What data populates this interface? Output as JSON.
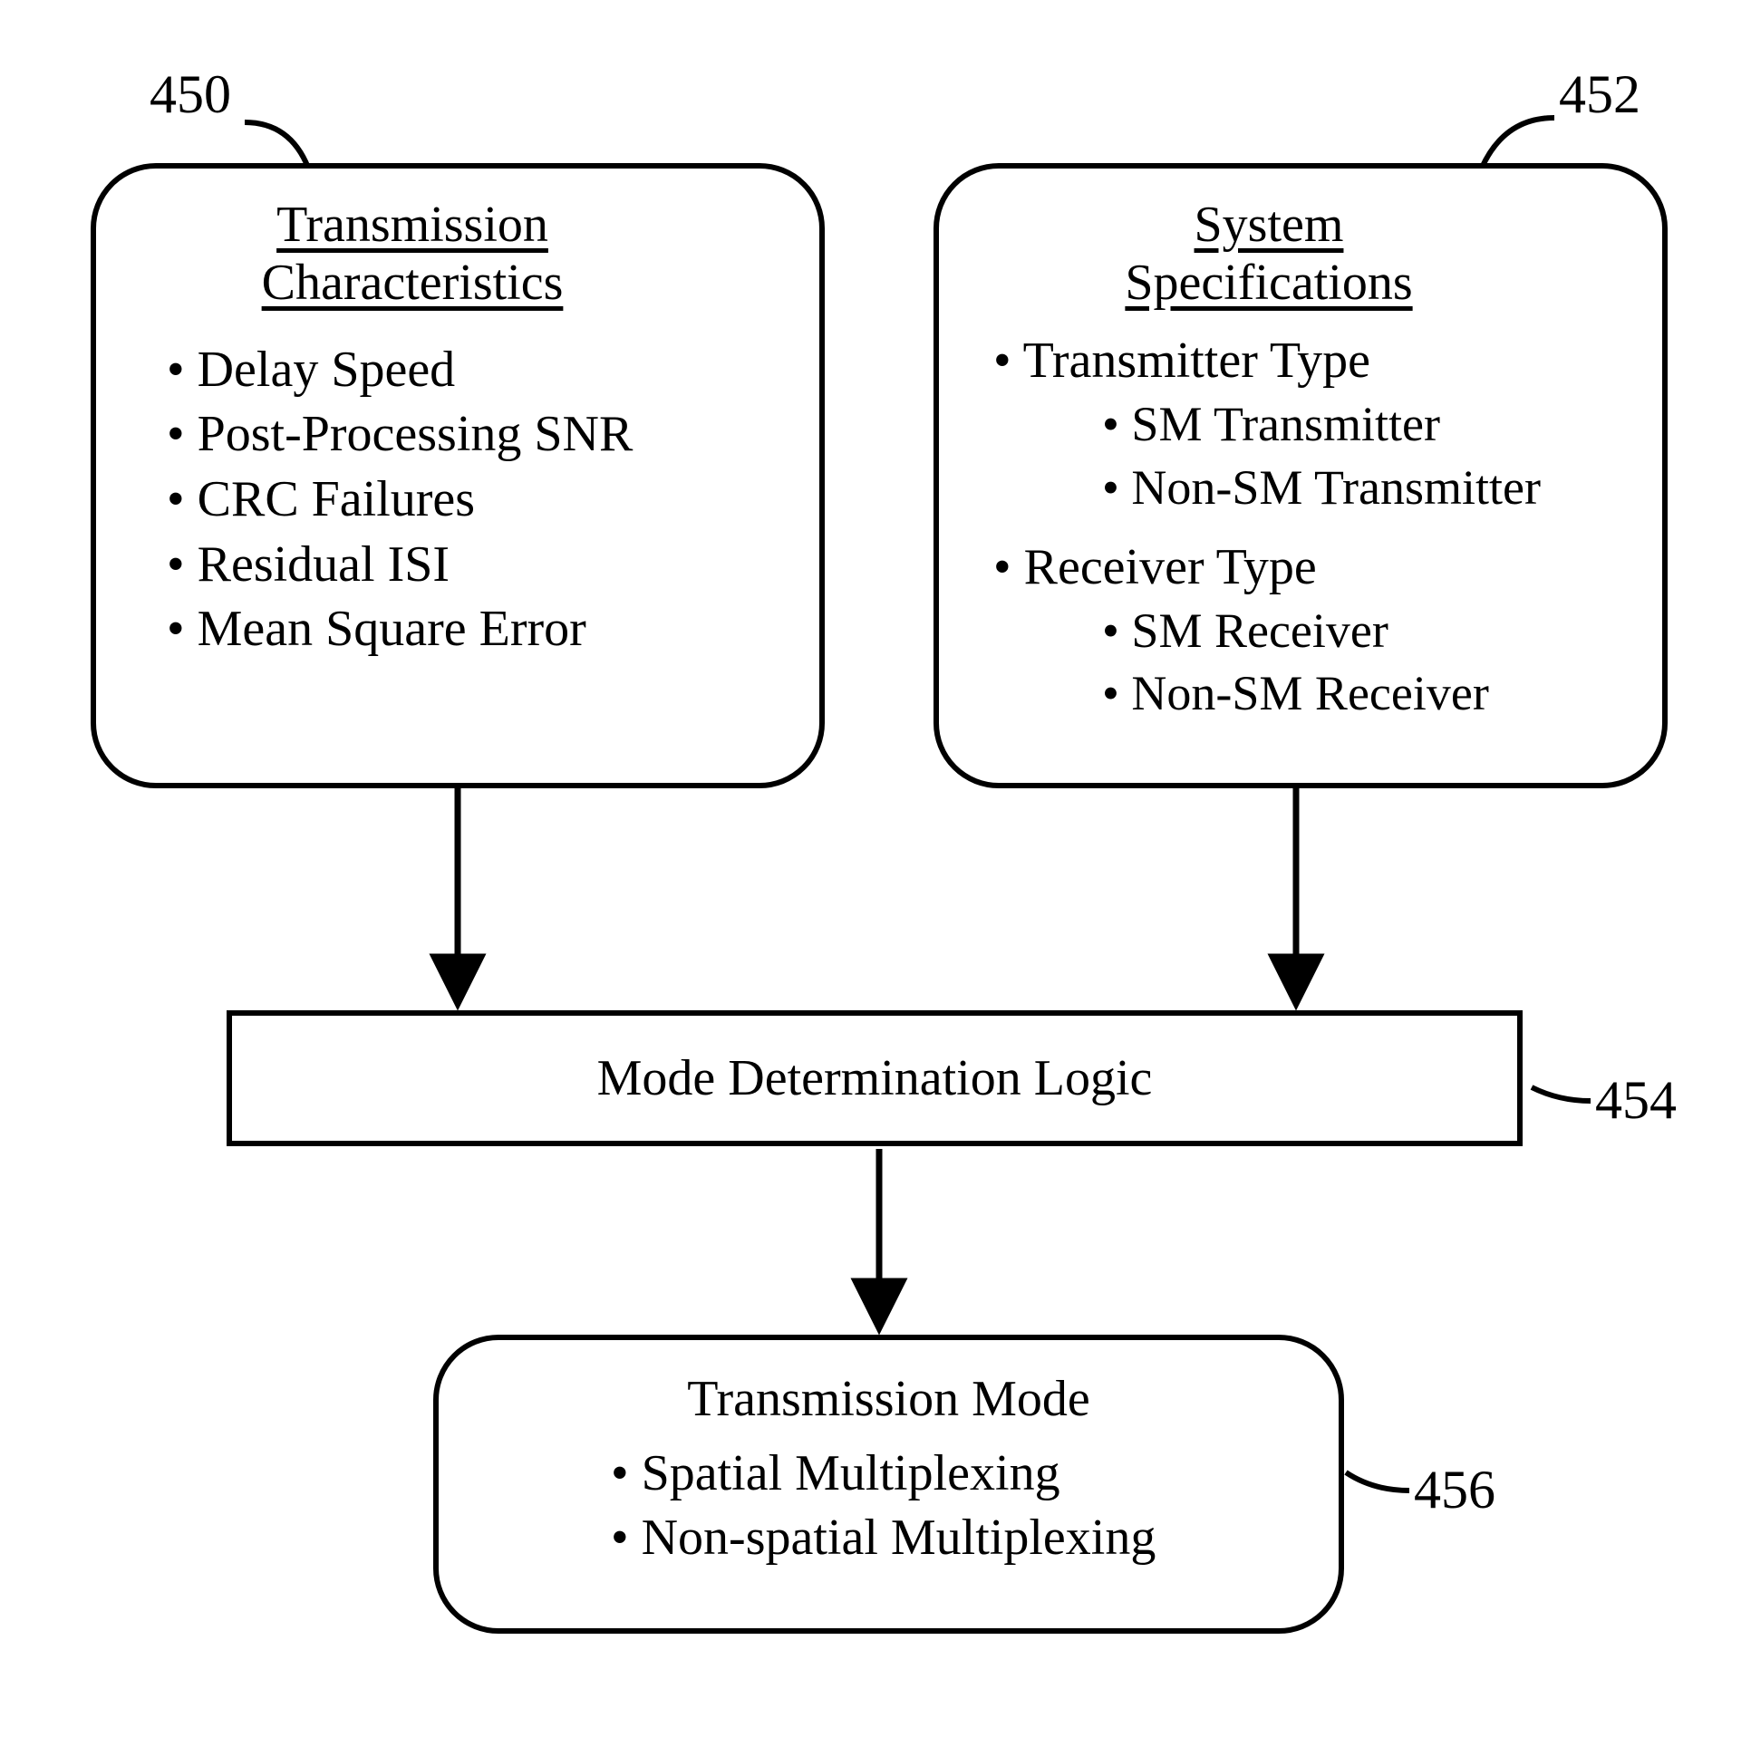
{
  "ref_labels": {
    "box_450": "450",
    "box_452": "452",
    "box_454": "454",
    "box_456": "456"
  },
  "box_450": {
    "title_line1": "Transmission",
    "title_line2": "Characteristics",
    "items": [
      "Delay Speed",
      "Post-Processing SNR",
      "CRC Failures",
      "Residual ISI",
      "Mean Square Error"
    ]
  },
  "box_452": {
    "title_line1": "System",
    "title_line2": "Specifications",
    "item1": "Transmitter Type",
    "item1_sub": [
      "SM Transmitter",
      "Non-SM Transmitter"
    ],
    "item2": "Receiver Type",
    "item2_sub": [
      "SM Receiver",
      "Non-SM Receiver"
    ]
  },
  "box_454": {
    "label": "Mode Determination Logic"
  },
  "box_456": {
    "title": "Transmission Mode",
    "items": [
      "Spatial Multiplexing",
      "Non-spatial Multiplexing"
    ]
  }
}
